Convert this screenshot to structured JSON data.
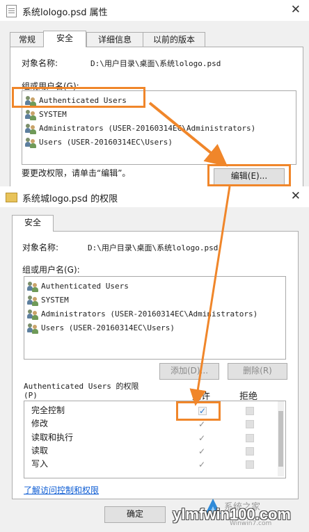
{
  "props_window": {
    "title": "系统lologo.psd 属性",
    "close_glyph": "✕",
    "tabs": [
      "常规",
      "安全",
      "详细信息",
      "以前的版本"
    ],
    "object_label": "对象名称:",
    "object_path": "D:\\用户目录\\桌面\\系统lologo.psd",
    "groups_label": "组或用户名(G):",
    "users": [
      "Authenticated Users",
      "SYSTEM",
      "Administrators (USER-20160314EC\\Administrators)",
      "Users (USER-20160314EC\\Users)"
    ],
    "change_hint": "要更改权限，请单击“编辑”。",
    "edit_button": "编辑(E)..."
  },
  "perm_window": {
    "title": "系统城logo.psd 的权限",
    "close_glyph": "✕",
    "tab": "安全",
    "object_label": "对象名称:",
    "object_path": "D:\\用户目录\\桌面\\系统lologo.psd",
    "groups_label": "组或用户名(G):",
    "users": [
      "Authenticated Users",
      "SYSTEM",
      "Administrators (USER-20160314EC\\Administrators)",
      "Users (USER-20160314EC\\Users)"
    ],
    "add_button": "添加(D)...",
    "remove_button": "删除(R)",
    "perms_label_line1": "Authenticated Users 的权限",
    "perms_label_line2": "(P)",
    "allow_header": "允许",
    "deny_header": "拒绝",
    "permissions": [
      {
        "name": "完全控制",
        "allow": true
      },
      {
        "name": "修改",
        "allow": true
      },
      {
        "name": "读取和执行",
        "allow": true
      },
      {
        "name": "读取",
        "allow": true
      },
      {
        "name": "写入",
        "allow": true
      }
    ],
    "check_glyph": "✓",
    "help_link": "了解访问控制和权限",
    "ok_button": "确定"
  },
  "watermark": {
    "brand": "ylmfwin100.com",
    "brand_alt": "Winwin7.com",
    "brand_cn": "系统之家"
  },
  "colors": {
    "highlight": "#f0862a",
    "link": "#0b5bd3",
    "check_blue": "#2a7ad3"
  }
}
